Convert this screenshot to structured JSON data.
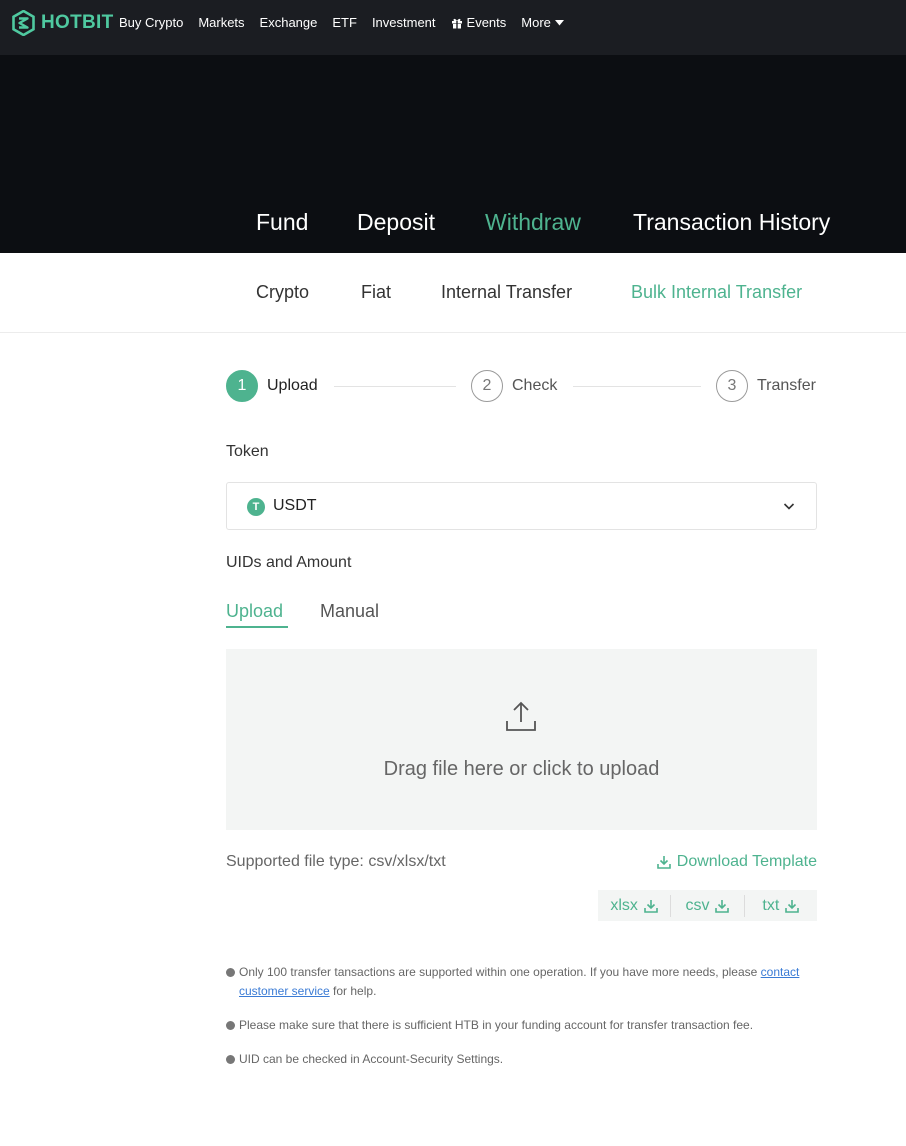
{
  "topnav": {
    "logo": "HOTBIT",
    "items": [
      {
        "label": "Buy Crypto"
      },
      {
        "label": "Markets"
      },
      {
        "label": "Exchange"
      },
      {
        "label": "ETF"
      },
      {
        "label": "Investment"
      },
      {
        "label": "Events",
        "icon": "gift-icon"
      },
      {
        "label": "More",
        "icon": "caret-down-icon"
      }
    ]
  },
  "main_tabs": [
    "Fund",
    "Deposit",
    "Withdraw",
    "Transaction History"
  ],
  "main_tab_active": "Withdraw",
  "sub_tabs": [
    "Crypto",
    "Fiat",
    "Internal Transfer",
    "Bulk Internal Transfer"
  ],
  "sub_tab_active": "Bulk Internal Transfer",
  "steps": [
    {
      "number": "1",
      "label": "Upload",
      "active": true
    },
    {
      "number": "2",
      "label": "Check",
      "active": false
    },
    {
      "number": "3",
      "label": "Transfer",
      "active": false
    }
  ],
  "token": {
    "label": "Token",
    "selected": "USDT",
    "icon_letter": "T"
  },
  "uids": {
    "label": "UIDs and Amount",
    "tabs": [
      "Upload",
      "Manual"
    ],
    "active_tab": "Upload"
  },
  "dropzone": {
    "text": "Drag file here or click to upload"
  },
  "supported_types": "Supported file type: csv/xlsx/txt",
  "download_template": "Download Template",
  "formats": [
    "xlsx",
    "csv",
    "txt"
  ],
  "notes": {
    "note1_before": "Only 100 transfer tansactions are supported within one operation. If you have more needs, please",
    "note1_link": "contact customer service",
    "note1_after": " for help.",
    "note2": "Please make sure that there is sufficient HTB in your funding account for transfer transaction fee.",
    "note3": "UID can be checked in Account-Security Settings."
  },
  "colors": {
    "accent": "#4eb38f",
    "nav_bg": "#1b1d22",
    "hero_bg": "#0c0e12",
    "logo": "#4fc9a0"
  }
}
